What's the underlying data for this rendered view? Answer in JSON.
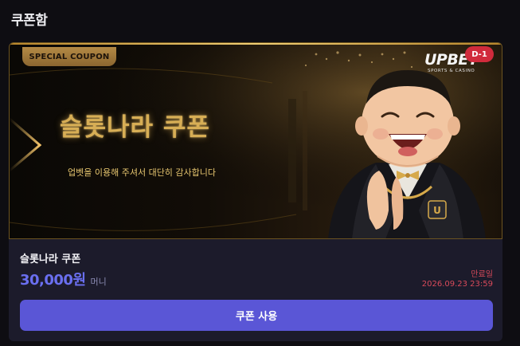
{
  "page": {
    "title": "쿠폰함"
  },
  "coupon": {
    "banner": {
      "tag": "SPECIAL COUPON",
      "title": "슬롯나라 쿠폰",
      "subtitle": "업벳을 이용해 주셔서 대단히 감사합니다",
      "brand_name": "UPBET",
      "brand_tagline": "SPORTS & CASINO",
      "dday": "D-1",
      "mascot": "laughing-mascot"
    },
    "name": "슬롯나라 쿠폰",
    "amount": "30,000원",
    "amount_unit": "머니",
    "expiry_label": "만료일",
    "expiry_date": "2026.09.23 23:59",
    "use_button_label": "쿠폰 사용"
  },
  "colors": {
    "background": "#0e0d12",
    "card": "#1c1b2b",
    "accent_amount": "#6a6ff0",
    "button": "#5a56d6",
    "expiry": "#d84a5a",
    "gold": "#d7ae55",
    "dday_badge": "#d12b3c"
  }
}
